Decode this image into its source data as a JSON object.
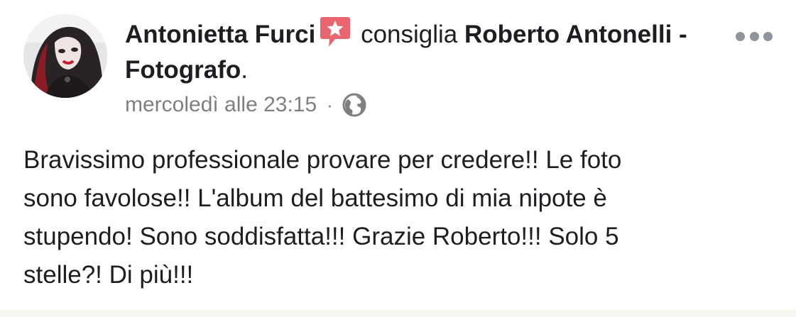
{
  "author": {
    "name": "Antonietta Furci",
    "verb": "consiglia",
    "page_name": "Roberto Antonelli - Fotografo",
    "page_suffix": "."
  },
  "icons": {
    "recommendation": "recommend-badge-icon",
    "privacy": "globe-icon",
    "more": "more-options-icon"
  },
  "meta": {
    "timestamp": "mercoledì alle 23:15",
    "separator": "·"
  },
  "post": {
    "lines": [
      "Bravissimo professionale provare per credere!! Le foto",
      "sono favolose!! L'album del battesimo di mia nipote è",
      "stupendo! Sono soddisfatta!!! Grazie Roberto!!! Solo 5",
      "stelle?! Di più!!!"
    ]
  },
  "colors": {
    "badge": "#e9666e",
    "meta_text": "#7f7f7f",
    "more_dots": "#90949c"
  }
}
